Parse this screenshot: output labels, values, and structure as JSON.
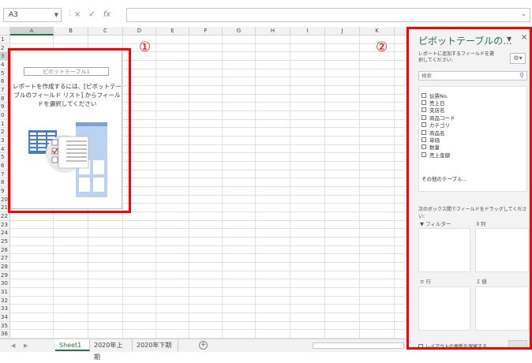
{
  "formula_bar": {
    "name_box": "A3",
    "cancel_icon": "×",
    "enter_icon": "✓",
    "fx": "fx"
  },
  "columns": [
    "A",
    "B",
    "C",
    "D",
    "E",
    "F",
    "G",
    "H",
    "I",
    "J",
    "K"
  ],
  "rows": [
    "1",
    "2",
    "3",
    "4",
    "5",
    "6",
    "7",
    "8",
    "9",
    "0",
    "1",
    "2",
    "3",
    "4",
    "5",
    "6",
    "7",
    "8",
    "9",
    "20",
    "21",
    "22",
    "23",
    "24",
    "25",
    "26",
    "27",
    "28",
    "29",
    "30",
    "31",
    "32",
    "33",
    "34",
    "35",
    "36"
  ],
  "pivot": {
    "title": "ピボットテーブル1",
    "message": "レポートを作成するには、[ピボットテーブルのフィールド リスト] からフィールドを選択してください"
  },
  "labels": {
    "one": "①",
    "two": "②"
  },
  "pane": {
    "title": "ピボットテーブルの...",
    "description": "レポートに追加するフィールドを選択してください:",
    "search_placeholder": "検索",
    "fields": [
      "伝票No.",
      "売上日",
      "支店名",
      "商品コード",
      "カテゴリ",
      "商品名",
      "単価",
      "数量",
      "売上金額"
    ],
    "more_tables": "その他のテーブル...",
    "drag_hint": "次のボックス間でフィールドをドラッグしてください:",
    "areas": {
      "filter": "フィルター",
      "columns": "列",
      "rows": "行",
      "values": "値"
    },
    "defer": "レイアウトの更新を保留する"
  },
  "sheets": [
    "Sheet1",
    "2020年上期",
    "2020年下期"
  ],
  "active_sheet": "Sheet1",
  "colors": {
    "accent": "#217346",
    "highlight": "#ff0000"
  }
}
